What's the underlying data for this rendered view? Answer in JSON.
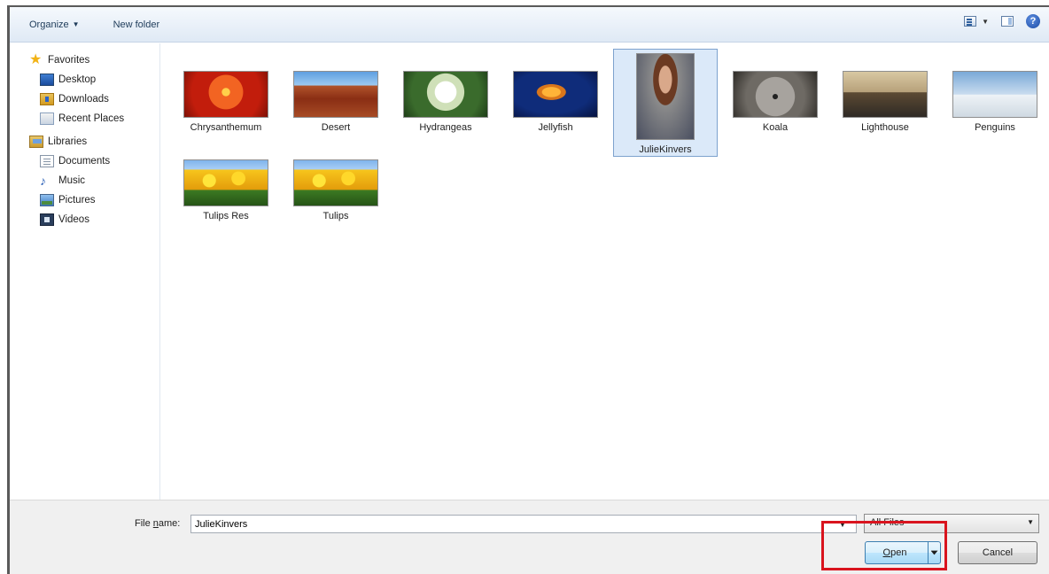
{
  "toolbar": {
    "organize_label": "Organize",
    "new_folder_label": "New folder"
  },
  "nav": {
    "favorites": {
      "label": "Favorites",
      "icon": "star-icon"
    },
    "favorites_items": [
      {
        "label": "Desktop",
        "icon": "desktop-icon"
      },
      {
        "label": "Downloads",
        "icon": "downloads-icon"
      },
      {
        "label": "Recent Places",
        "icon": "recent-places-icon"
      }
    ],
    "libraries": {
      "label": "Libraries",
      "icon": "libraries-icon"
    },
    "libraries_items": [
      {
        "label": "Documents",
        "icon": "documents-icon"
      },
      {
        "label": "Music",
        "icon": "music-icon"
      },
      {
        "label": "Pictures",
        "icon": "pictures-icon"
      },
      {
        "label": "Videos",
        "icon": "videos-icon"
      }
    ]
  },
  "files": [
    {
      "label": "Chrysanthemum"
    },
    {
      "label": "Desert"
    },
    {
      "label": "Hydrangeas"
    },
    {
      "label": "Jellyfish"
    },
    {
      "label": "JulieKinvers",
      "selected": true
    },
    {
      "label": "Koala"
    },
    {
      "label": "Lighthouse"
    },
    {
      "label": "Penguins"
    },
    {
      "label": "Tulips Res"
    },
    {
      "label": "Tulips"
    }
  ],
  "bottom": {
    "file_name_label_pre": "File ",
    "file_name_label_u": "n",
    "file_name_label_post": "ame:",
    "file_name_value": "JulieKinvers",
    "file_type_value": "All Files",
    "open_label_u": "O",
    "open_label_rest": "pen",
    "cancel_label": "Cancel"
  },
  "colors": {
    "highlight": "#d9141e",
    "selection": "#dbe9f9"
  }
}
